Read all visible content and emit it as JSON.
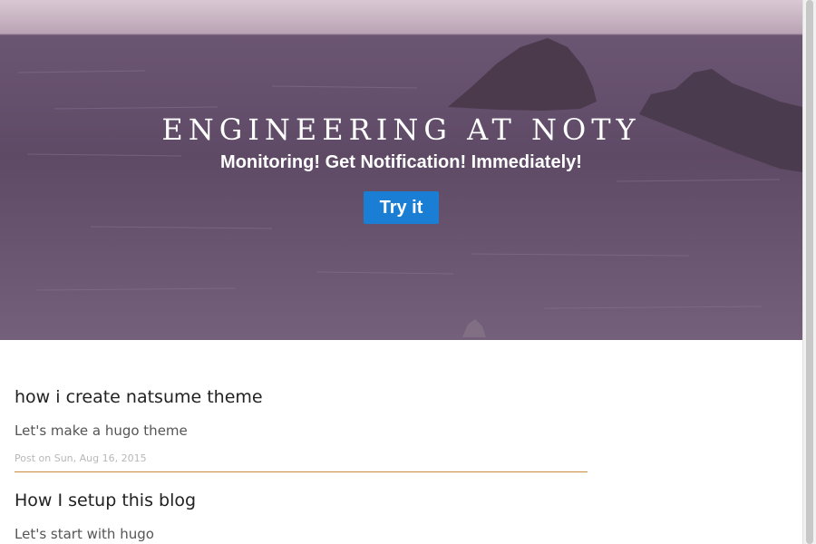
{
  "hero": {
    "title": "ENGINEERING AT NOTY",
    "subtitle": "Monitoring! Get Notification! Immediately!",
    "cta_label": "Try it"
  },
  "posts": [
    {
      "title": "how i create natsume theme",
      "summary": "Let's make a hugo theme",
      "meta": "Post on Sun, Aug 16, 2015"
    },
    {
      "title": "How I setup this blog",
      "summary": "Let's start with hugo"
    }
  ],
  "colors": {
    "accent": "#1a7fd4",
    "divider": "#c8893e"
  }
}
